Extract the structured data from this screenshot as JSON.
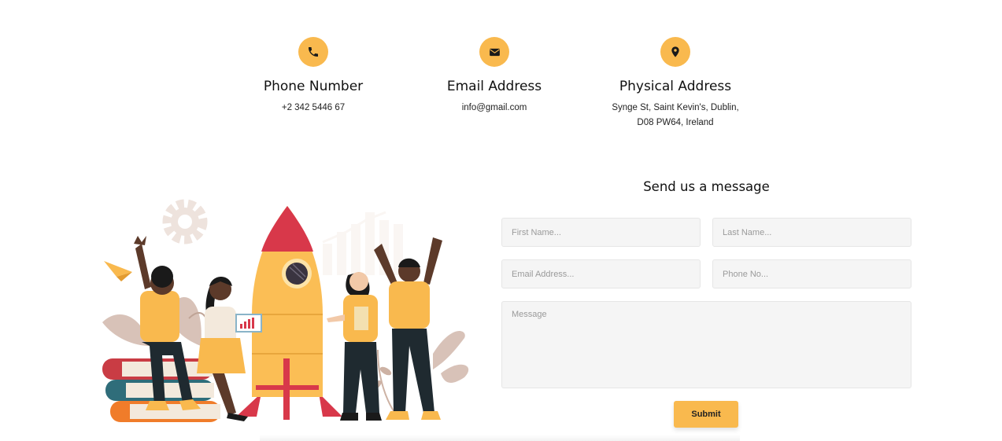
{
  "contact": {
    "phone": {
      "title": "Phone Number",
      "value": "+2 342 5446 67",
      "icon": "phone-icon"
    },
    "email": {
      "title": "Email Address",
      "value": "info@gmail.com",
      "icon": "envelope-icon"
    },
    "address": {
      "title": "Physical Address",
      "line1": "Synge St, Saint Kevin's, Dublin,",
      "line2": "D08 PW64, Ireland",
      "icon": "location-pin-icon"
    }
  },
  "form": {
    "title": "Send us a message",
    "first_name_placeholder": "First Name...",
    "last_name_placeholder": "Last Name...",
    "email_placeholder": "Email Address...",
    "phone_placeholder": "Phone No...",
    "message_placeholder": "Message",
    "submit_label": "Submit"
  },
  "colors": {
    "accent": "#f9b94e",
    "field_bg": "#f5f5f5",
    "rocket_body": "#fbbe55",
    "rocket_red": "#d8384a",
    "skin": "#5c3a2a",
    "dark_clothes": "#1f2a30"
  }
}
